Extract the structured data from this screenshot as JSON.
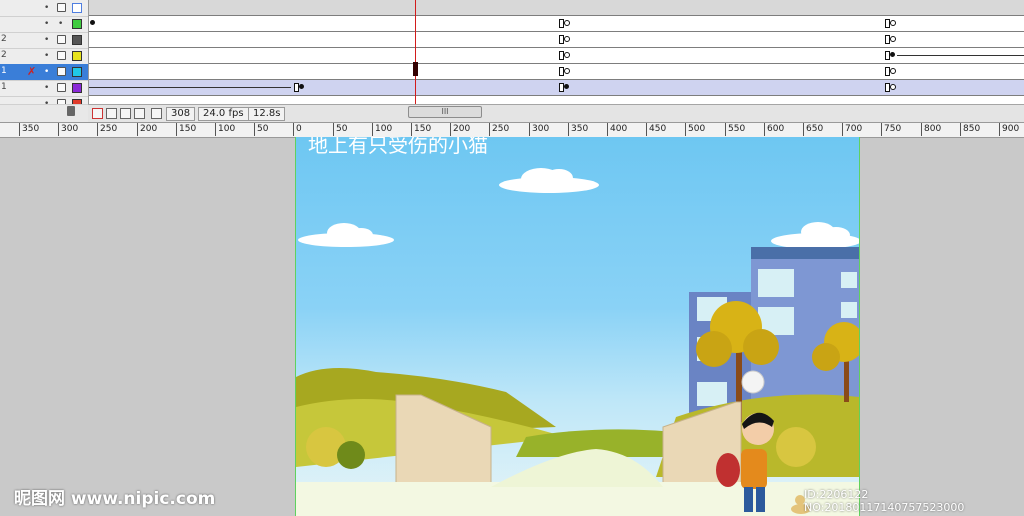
{
  "timeline": {
    "layers": [
      {
        "num": "",
        "swatch": "#4f7ee0"
      },
      {
        "num": "",
        "swatch": "#3fcc3f"
      },
      {
        "num": "2",
        "swatch": "#555555"
      },
      {
        "num": "2",
        "swatch": "#e6e21c"
      },
      {
        "num": "1",
        "swatch": "#20c8e6",
        "selected": true
      },
      {
        "num": "1",
        "swatch": "#8a2ad8"
      },
      {
        "num": "",
        "swatch": "#e03a2a"
      }
    ],
    "current_frame": "308",
    "fps": "24.0 fps",
    "elapsed": "12.8s",
    "scroll_label": "III"
  },
  "ruler": {
    "labels": [
      "350",
      "300",
      "250",
      "200",
      "150",
      "100",
      "50",
      "0",
      "50",
      "100",
      "150",
      "200",
      "250",
      "300",
      "350",
      "400",
      "450",
      "500",
      "550",
      "600",
      "650",
      "700",
      "750",
      "800",
      "850",
      "900"
    ]
  },
  "stage": {
    "title": "地上有只受伤的小猫",
    "colors": {
      "sky_top": "#6ec7f2",
      "grass": "#b9b82b",
      "ground": "#f3f8e2",
      "building": "#6a84c4"
    }
  },
  "watermark": {
    "left": "昵图网 www.nipic.com",
    "right": "ID:2206122 NO:20180117140757523000"
  },
  "icons": [
    "lock-icon",
    "eye-dot-icon",
    "pencil-x-icon",
    "trash-icon",
    "onion-skin-icon",
    "center-frame-icon"
  ]
}
